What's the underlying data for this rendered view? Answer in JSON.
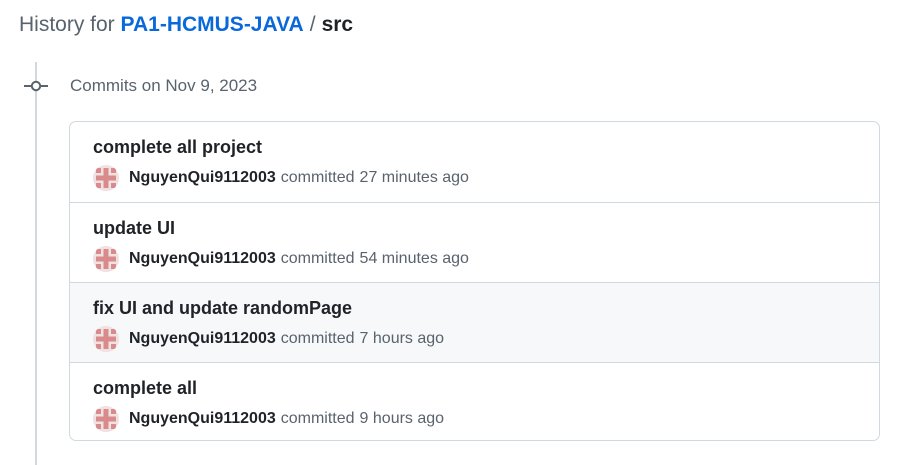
{
  "header": {
    "prefix": "History for",
    "repo": "PA1-HCMUS-JAVA",
    "separator": "/",
    "path": "src"
  },
  "group": {
    "label": "Commits on Nov 9, 2023",
    "icon": "git-commit-icon"
  },
  "commits": [
    {
      "title": "complete all project",
      "author": "NguyenQui9112003",
      "action": "committed",
      "time": "27 minutes ago",
      "avatar_color": "#d98a8a"
    },
    {
      "title": "update UI",
      "author": "NguyenQui9112003",
      "action": "committed",
      "time": "54 minutes ago",
      "avatar_color": "#d98a8a"
    },
    {
      "title": "fix UI and update randomPage",
      "author": "NguyenQui9112003",
      "action": "committed",
      "time": "7 hours ago",
      "avatar_color": "#d98a8a"
    },
    {
      "title": "complete all",
      "author": "NguyenQui9112003",
      "action": "committed",
      "time": "9 hours ago",
      "avatar_color": "#d98a8a"
    }
  ],
  "colors": {
    "link": "#0969da",
    "muted": "#59636e",
    "border": "#d1d9e0",
    "hover_row": "#f6f8fa"
  }
}
